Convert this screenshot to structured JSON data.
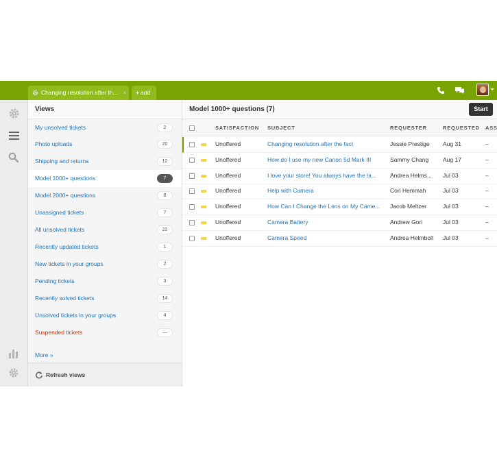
{
  "topbar": {
    "active_tab": "Changing resolution after th...",
    "add_tab": "add"
  },
  "views": {
    "heading": "Views",
    "items": [
      {
        "label": "My unsolved tickets",
        "count": "2"
      },
      {
        "label": "Photo uploads",
        "count": "20"
      },
      {
        "label": "Shipping and returns",
        "count": "12"
      },
      {
        "label": "Model 1000+ questions",
        "count": "7"
      },
      {
        "label": "Model 2000+ questions",
        "count": "8"
      },
      {
        "label": "Unassigned tickets",
        "count": "7"
      },
      {
        "label": "All unsolved tickets",
        "count": "22"
      },
      {
        "label": "Recently updated tickets",
        "count": "1"
      },
      {
        "label": "New tickets in your groups",
        "count": "2"
      },
      {
        "label": "Pending tickets",
        "count": "3"
      },
      {
        "label": "Recently solved tickets",
        "count": "14"
      },
      {
        "label": "Unsolved tickets in your groups",
        "count": "4"
      },
      {
        "label": "Suspended tickets",
        "count": "—"
      }
    ],
    "more": "More »",
    "refresh": "Refresh views"
  },
  "main": {
    "title": "Model 1000+ questions (7)",
    "start_button": "Start",
    "columns": [
      "SATISFACTION",
      "SUBJECT",
      "REQUESTER",
      "REQUESTED",
      "ASS"
    ],
    "rows": [
      {
        "satisfaction": "Unoffered",
        "subject": "Changing resolution after the fact",
        "requester": "Jessie Prestige",
        "requested": "Aug 31",
        "assignee": "–"
      },
      {
        "satisfaction": "Unoffered",
        "subject": "How do I use my new Canon 5d Mark III",
        "requester": "Sammy Chang",
        "requested": "Aug 17",
        "assignee": "–"
      },
      {
        "satisfaction": "Unoffered",
        "subject": "I love your store! You always have the la...",
        "requester": "Andrea Helms...",
        "requested": "Jul 03",
        "assignee": "–"
      },
      {
        "satisfaction": "Unoffered",
        "subject": "Help with Camera",
        "requester": "Cori Hemmah",
        "requested": "Jul 03",
        "assignee": "–"
      },
      {
        "satisfaction": "Unoffered",
        "subject": "How Can I Change the Lens on My Came...",
        "requester": "Jacob Meltzer",
        "requested": "Jul 03",
        "assignee": "–"
      },
      {
        "satisfaction": "Unoffered",
        "subject": "Camera Battery",
        "requester": "Andrew Gori",
        "requested": "Jul 03",
        "assignee": "–"
      },
      {
        "satisfaction": "Unoffered",
        "subject": "Camera Speed",
        "requester": "Andrea Helmbolt",
        "requested": "Jul 03",
        "assignee": "–"
      }
    ]
  },
  "colors": {
    "brand_green": "#78a300",
    "link_blue": "#1f73b7",
    "suspended_red": "#cc3300",
    "priority_yellow": "#f4d346"
  },
  "icons": [
    "gear-icon",
    "phone-icon",
    "chat-icon",
    "avatar",
    "menu-icon",
    "search-icon",
    "reports-icon",
    "settings-icon",
    "refresh-icon"
  ]
}
